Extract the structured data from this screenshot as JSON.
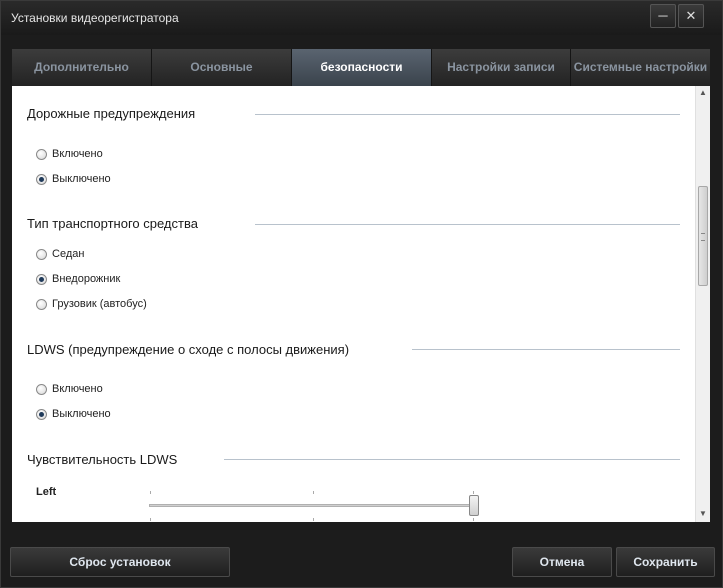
{
  "window": {
    "title": "Установки видеорегистратора",
    "minimize_glyph": "─",
    "close_glyph": "✕"
  },
  "tabs": [
    {
      "label": "Дополнительно",
      "active": false
    },
    {
      "label": "Основные",
      "active": false
    },
    {
      "label": "безопасности",
      "active": true
    },
    {
      "label": "Настройки записи",
      "active": false
    },
    {
      "label": "Системные настройки",
      "active": false
    }
  ],
  "sections": {
    "road_warnings": {
      "title": "Дорожные предупреждения",
      "options": [
        {
          "label": "Включено",
          "selected": false
        },
        {
          "label": "Выключено",
          "selected": true
        }
      ]
    },
    "vehicle_type": {
      "title": "Тип транспортного средства",
      "options": [
        {
          "label": "Седан",
          "selected": false
        },
        {
          "label": "Внедорожник",
          "selected": true
        },
        {
          "label": "Грузовик (автобус)",
          "selected": false
        }
      ]
    },
    "ldws": {
      "title": "LDWS (предупреждение о сходе с полосы движения)",
      "options": [
        {
          "label": "Включено",
          "selected": false
        },
        {
          "label": "Выключено",
          "selected": true
        }
      ]
    },
    "ldws_sensitivity": {
      "title": "Чувствительность LDWS",
      "slider_label": "Left",
      "slider_value_fraction": 1.0
    }
  },
  "scrollbar": {
    "up_glyph": "▲",
    "down_glyph": "▼"
  },
  "footer": {
    "reset_label": "Сброс установок",
    "cancel_label": "Отмена",
    "save_label": "Сохранить"
  }
}
